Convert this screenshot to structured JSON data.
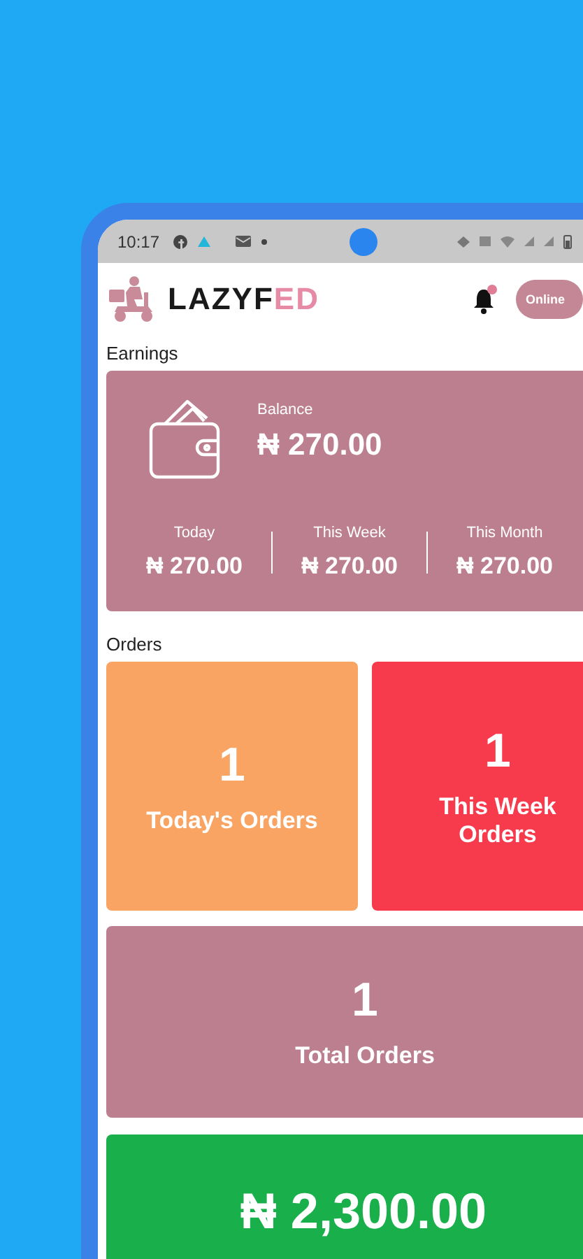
{
  "status_bar": {
    "time": "10:17"
  },
  "header": {
    "logo": [
      "LAZYF",
      "ED"
    ],
    "has_notification": true,
    "status": "Online"
  },
  "earnings": {
    "title": "Earnings",
    "balance": {
      "label": "Balance",
      "amount": "₦ 270.00"
    },
    "periods": [
      {
        "label": "Today",
        "amount": "₦ 270.00"
      },
      {
        "label": "This Week",
        "amount": "₦ 270.00"
      },
      {
        "label": "This Month",
        "amount": "₦ 270.00"
      }
    ]
  },
  "orders": {
    "title": "Orders",
    "cards": [
      {
        "count": "1",
        "label": "Today's Orders",
        "color": "#f9a463",
        "wide": false
      },
      {
        "count": "1",
        "label": "This Week Orders",
        "color": "#f73b4d",
        "wide": false
      },
      {
        "count": "1",
        "label": "Total Orders",
        "color": "#bb7f8f",
        "wide": true
      }
    ]
  },
  "revenue_card": {
    "amount": "₦ 2,300.00"
  }
}
